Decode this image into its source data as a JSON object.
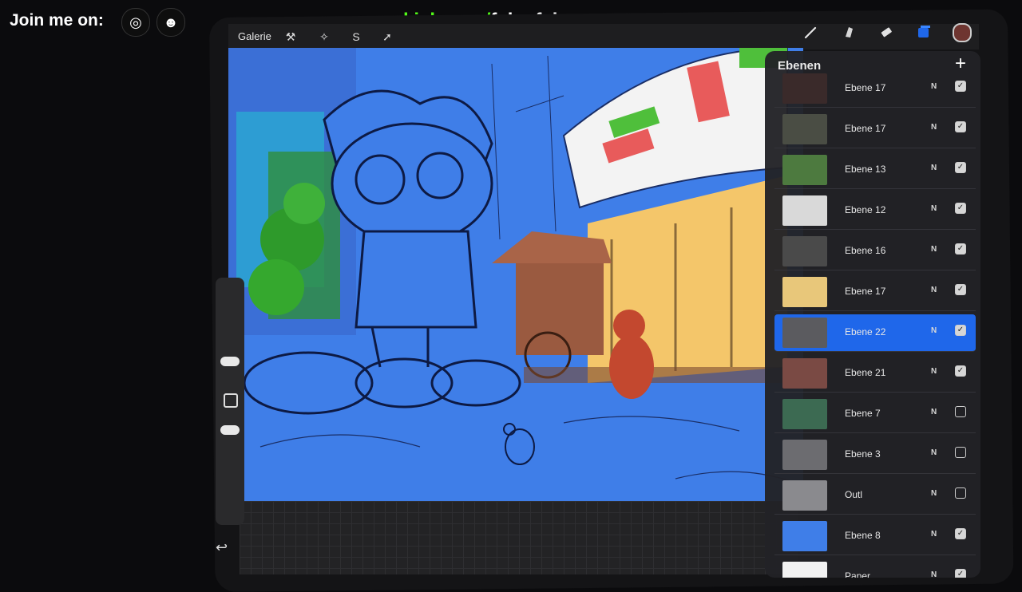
{
  "overlay": {
    "join_text": "Join me on:",
    "kick_prefix": "kick.com/",
    "kick_user": "falcofalcrow",
    "kick_color": "#53fc18",
    "socials": [
      {
        "name": "instagram-icon",
        "glyph": "◎"
      },
      {
        "name": "discord-icon",
        "glyph": "☻"
      }
    ]
  },
  "toolbar": {
    "gallery_label": "Galerie",
    "left_tools": [
      {
        "name": "wrench-icon",
        "glyph": "⚒"
      },
      {
        "name": "magic-wand-icon",
        "glyph": "✧"
      },
      {
        "name": "selection-icon",
        "glyph": "S"
      },
      {
        "name": "transform-arrow-icon",
        "glyph": "➚"
      }
    ],
    "right_tools": [
      {
        "name": "brush-icon"
      },
      {
        "name": "smudge-icon"
      },
      {
        "name": "eraser-icon"
      },
      {
        "name": "layers-icon"
      }
    ],
    "current_color": "#6e3530"
  },
  "layers_panel": {
    "title": "Ebenen",
    "add_glyph": "+",
    "layers": [
      {
        "name": "Ebene 17",
        "mode": "N",
        "visible": true,
        "thumb": "#3a2a2a"
      },
      {
        "name": "Ebene 17",
        "mode": "N",
        "visible": true,
        "thumb": "#4a4d44"
      },
      {
        "name": "Ebene 13",
        "mode": "N",
        "visible": true,
        "thumb": "#4d7a3f"
      },
      {
        "name": "Ebene 12",
        "mode": "N",
        "visible": true,
        "thumb": "#d9d9d9"
      },
      {
        "name": "Ebene 16",
        "mode": "N",
        "visible": true,
        "thumb": "#4a4a4a"
      },
      {
        "name": "Ebene 17",
        "mode": "N",
        "visible": true,
        "thumb": "#e8c77a"
      },
      {
        "name": "Ebene 22",
        "mode": "N",
        "visible": true,
        "thumb": "#5b5b5f",
        "active": true
      },
      {
        "name": "Ebene 21",
        "mode": "N",
        "visible": true,
        "thumb": "#7a4a44"
      },
      {
        "name": "Ebene 7",
        "mode": "N",
        "visible": false,
        "thumb": "#3c6a52"
      },
      {
        "name": "Ebene 3",
        "mode": "N",
        "visible": false,
        "thumb": "#6c6c70"
      },
      {
        "name": "Outl",
        "mode": "N",
        "visible": false,
        "thumb": "#8a8a8e"
      },
      {
        "name": "Ebene 8",
        "mode": "N",
        "visible": true,
        "thumb": "#3f7ee8"
      },
      {
        "name": "Paper",
        "mode": "N",
        "visible": true,
        "thumb": "#f2f2f2"
      }
    ]
  },
  "canvas_colors": {
    "background": "#3f7ee8",
    "shop": "#f4c66a",
    "cart": "#9a5a40",
    "figure": "#c3482f"
  }
}
